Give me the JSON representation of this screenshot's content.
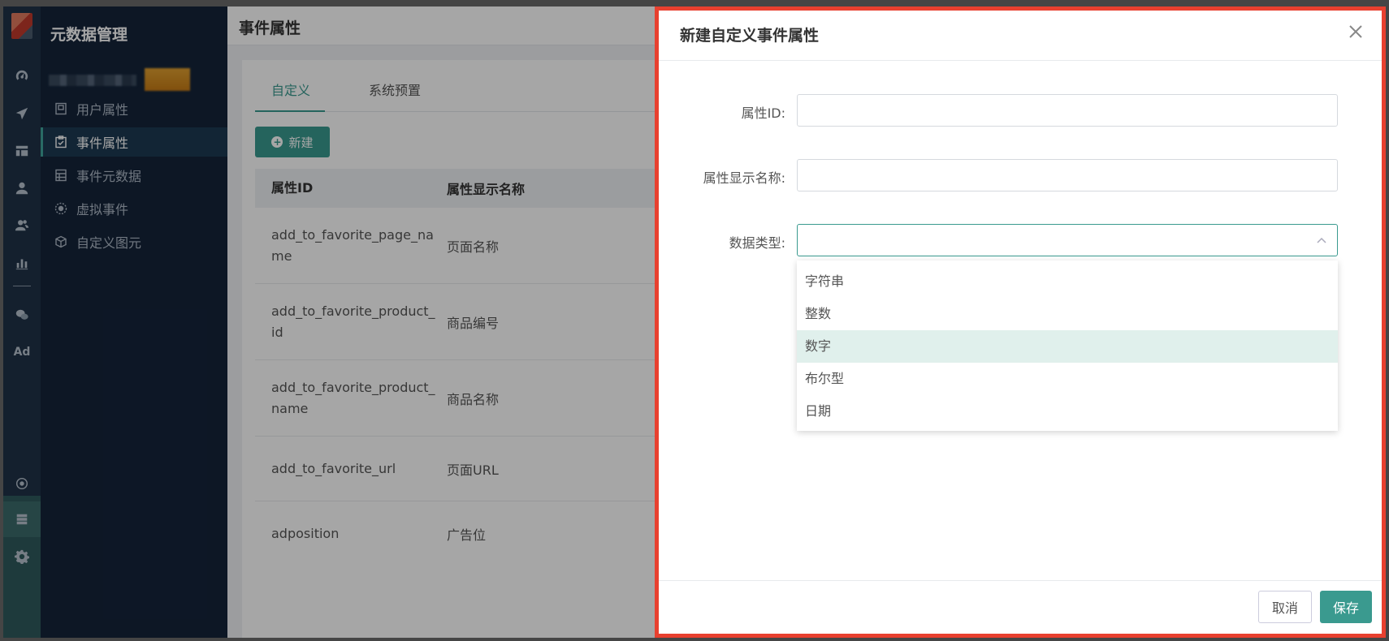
{
  "app": {
    "section_title": "元数据管理"
  },
  "sidebar": {
    "items": [
      {
        "label": "用户属性",
        "icon": "user-attr-icon"
      },
      {
        "label": "事件属性",
        "icon": "event-attr-icon",
        "active": true
      },
      {
        "label": "事件元数据",
        "icon": "event-meta-icon"
      },
      {
        "label": "虚拟事件",
        "icon": "virtual-event-icon"
      },
      {
        "label": "自定义图元",
        "icon": "custom-element-icon"
      }
    ]
  },
  "rail": {
    "ad_label": "Ad"
  },
  "page": {
    "title": "事件属性"
  },
  "tabs": [
    {
      "label": "自定义",
      "active": true
    },
    {
      "label": "系统预置"
    }
  ],
  "toolbar": {
    "new_label": "新建"
  },
  "table": {
    "headers": [
      "属性ID",
      "属性显示名称"
    ],
    "rows": [
      {
        "id": "add_to_favorite_page_na\nme",
        "name": "页面名称"
      },
      {
        "id": "add_to_favorite_product_\nid",
        "name": "商品编号"
      },
      {
        "id": "add_to_favorite_product_\nname",
        "name": "商品名称"
      },
      {
        "id": "add_to_favorite_url",
        "name": "页面URL"
      },
      {
        "id": "adposition",
        "name": "广告位"
      }
    ]
  },
  "drawer": {
    "title": "新建自定义事件属性",
    "fields": {
      "attr_id_label": "属性ID:",
      "attr_id_value": "",
      "display_name_label": "属性显示名称:",
      "display_name_value": "",
      "data_type_label": "数据类型:",
      "data_type_value": ""
    },
    "options": [
      "字符串",
      "整数",
      "数字",
      "布尔型",
      "日期"
    ],
    "highlighted_option": "数字",
    "cancel_label": "取消",
    "save_label": "保存"
  },
  "colors": {
    "accent": "#3a9a8f",
    "highlight": "#e8402f",
    "nav_bg": "#14243a",
    "rail_bg": "#1f3247"
  }
}
